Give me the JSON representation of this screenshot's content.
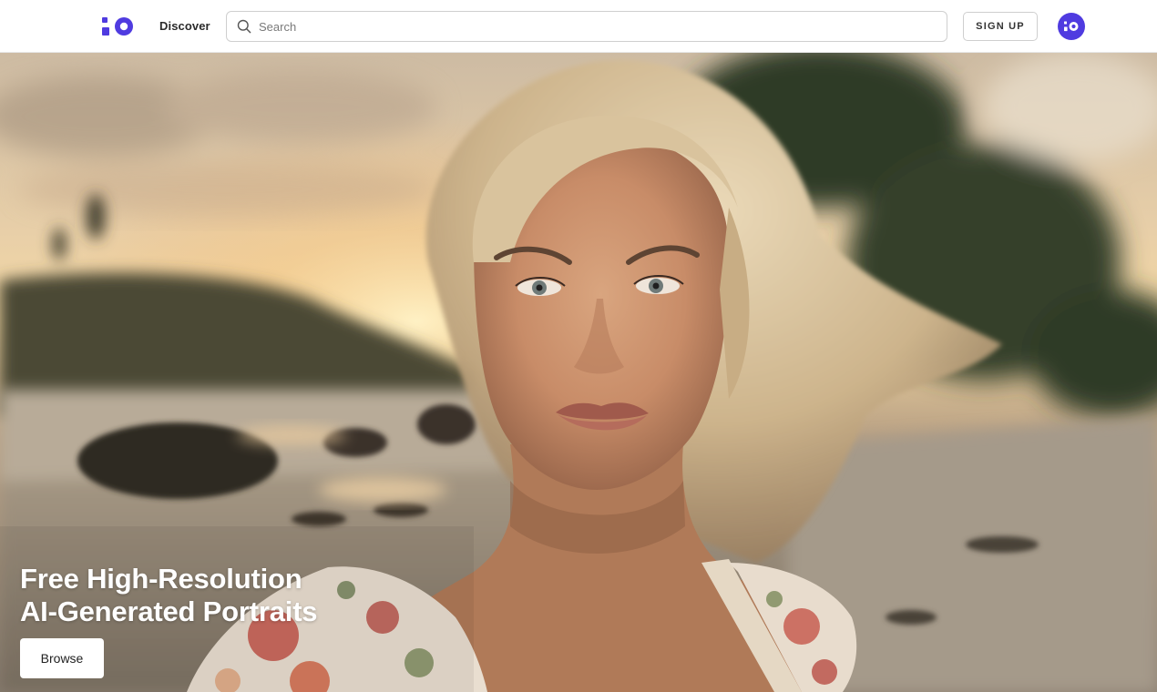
{
  "header": {
    "logo_icon": "unsplash-style-logo",
    "nav": {
      "discover_label": "Discover"
    },
    "search": {
      "placeholder": "Search",
      "value": ""
    },
    "signup_label": "SIGN UP",
    "avatar_icon": "logo-avatar"
  },
  "hero": {
    "title_line1": "Free High-Resolution",
    "title_line2": "AI-Generated Portraits",
    "browse_label": "Browse",
    "image_subject": "portrait of a blonde woman on a beach at sunset"
  },
  "colors": {
    "brand": "#4f3be0",
    "text_dark": "#2b2b2b",
    "border": "#cfcfcf"
  }
}
